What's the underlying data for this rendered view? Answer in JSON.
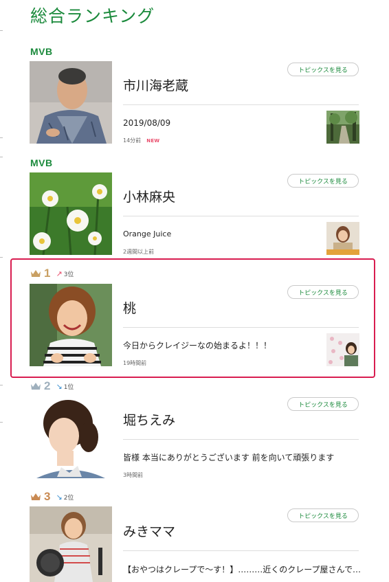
{
  "page_title": "総合ランキング",
  "topics_button_label": "トピックスを見る",
  "new_badge": "NEW",
  "entries": [
    {
      "label": "MVB",
      "name": "市川海老蔵",
      "topic": "2019/08/09",
      "time": "14分前",
      "is_new": true,
      "photo": "portrait-man-kimono",
      "topic_thumb": "forest-path"
    },
    {
      "label": "MVB",
      "name": "小林麻央",
      "topic": "Orange Juice",
      "time": "2週間以上前",
      "is_new": false,
      "photo": "daisy-flowers",
      "topic_thumb": "woman-with-drink"
    },
    {
      "rank": "1",
      "rank_color": "#c9a063",
      "move": "3位",
      "move_dir": "up",
      "name": "桃",
      "topic": "今日からクレイジーなの始まるよ！！！",
      "time": "19時間前",
      "is_new": false,
      "photo": "smiling-woman-striped-shirt",
      "topic_thumb": "woman-by-wall",
      "highlighted": true
    },
    {
      "rank": "2",
      "rank_color": "#9fb0bd",
      "move": "1位",
      "move_dir": "down",
      "name": "堀ちえみ",
      "topic": "皆様 本当にありがとうございます 前を向いて頑張ります",
      "time": "3時間前",
      "is_new": false,
      "photo": "woman-profile-braided-hair"
    },
    {
      "rank": "3",
      "rank_color": "#c98a52",
      "move": "2位",
      "move_dir": "down",
      "name": "みきママ",
      "topic": "【おやつはクレープで～す！】………近くのクレープ屋さんで…",
      "photo": "woman-holding-frying-pans"
    }
  ],
  "colors": {
    "brand_green": "#1b8a3c",
    "highlight_border": "#d81c4f",
    "up_arrow": "#e94b6a",
    "down_arrow": "#3a8fd0"
  }
}
